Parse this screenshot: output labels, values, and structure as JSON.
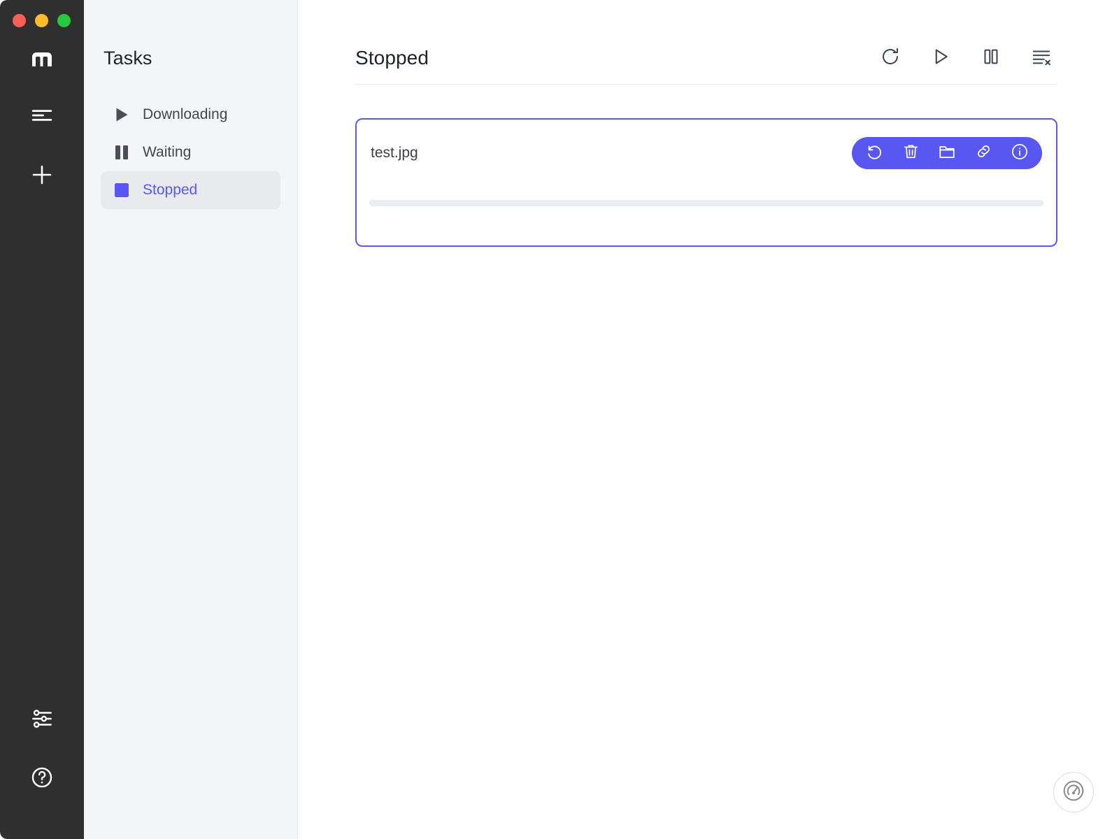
{
  "window": {
    "controls": [
      {
        "name": "close",
        "color": "#ff5f57"
      },
      {
        "name": "minimize",
        "color": "#febc2e"
      },
      {
        "name": "maximize",
        "color": "#28c840"
      }
    ]
  },
  "rail": {
    "logo": "m",
    "logo_icon": "motrix-logo-icon",
    "items": [
      {
        "icon": "task-list-icon",
        "label": "Tasks"
      },
      {
        "icon": "plus-icon",
        "label": "Add Task"
      }
    ],
    "bottom_items": [
      {
        "icon": "sliders-preferences-icon",
        "label": "Preferences"
      },
      {
        "icon": "question-circle-icon",
        "label": "Help"
      }
    ]
  },
  "sidebar": {
    "title": "Tasks",
    "items": [
      {
        "label": "Downloading",
        "icon": "play-triangle-icon",
        "active": false
      },
      {
        "label": "Waiting",
        "icon": "pause-bars-icon",
        "active": false
      },
      {
        "label": "Stopped",
        "icon": "stop-square-icon",
        "active": true
      }
    ]
  },
  "main": {
    "title": "Stopped",
    "toolbar": [
      {
        "icon": "refresh-icon",
        "label": "Refresh"
      },
      {
        "icon": "play-icon",
        "label": "Resume All"
      },
      {
        "icon": "pause-icon",
        "label": "Pause All"
      },
      {
        "icon": "clear-list-icon",
        "label": "Clear Completed"
      }
    ],
    "tasks": [
      {
        "filename": "test.jpg",
        "progress_percent": 0,
        "selected": true,
        "actions": [
          {
            "icon": "restart-icon",
            "label": "Restart"
          },
          {
            "icon": "trash-icon",
            "label": "Delete"
          },
          {
            "icon": "folder-icon",
            "label": "Open Folder"
          },
          {
            "icon": "link-icon",
            "label": "Copy Link"
          },
          {
            "icon": "info-icon",
            "label": "Info"
          }
        ]
      }
    ],
    "speed_fab": {
      "icon": "speedometer-icon",
      "label": "Speed"
    }
  },
  "colors": {
    "accent": "#5957f2",
    "rail_bg": "#2f2f2f",
    "panel_bg": "#f4f5f7",
    "active_bg": "#e9eaee",
    "text": "#1f2329",
    "muted": "#43464d",
    "progress_track": "#e8ecf3"
  }
}
